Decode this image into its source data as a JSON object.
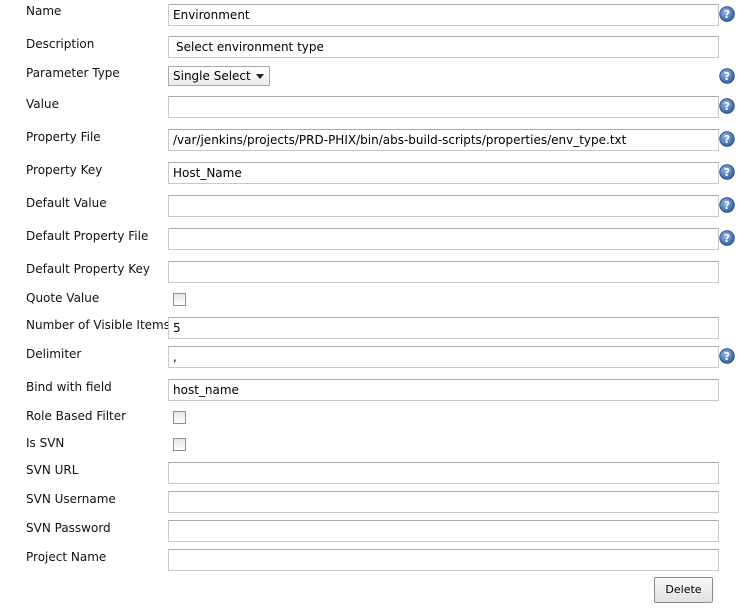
{
  "fields": {
    "name": {
      "label": "Name",
      "value": "Environment"
    },
    "description": {
      "label": "Description",
      "value": "Select environment type"
    },
    "parameter_type": {
      "label": "Parameter Type",
      "value": "Single Select"
    },
    "value": {
      "label": "Value",
      "value": ""
    },
    "property_file": {
      "label": "Property File",
      "value": "/var/jenkins/projects/PRD-PHIX/bin/abs-build-scripts/properties/env_type.txt"
    },
    "property_key": {
      "label": "Property Key",
      "value": "Host_Name"
    },
    "default_value": {
      "label": "Default Value",
      "value": ""
    },
    "default_property_file": {
      "label": "Default Property File",
      "value": ""
    },
    "default_property_key": {
      "label": "Default Property Key",
      "value": ""
    },
    "quote_value": {
      "label": "Quote Value",
      "checked": false
    },
    "visible_items": {
      "label": "Number of Visible Items",
      "value": "5"
    },
    "delimiter": {
      "label": "Delimiter",
      "value": ","
    },
    "bind_with_field": {
      "label": "Bind with field",
      "value": "host_name"
    },
    "role_based_filter": {
      "label": "Role Based Filter",
      "checked": false
    },
    "is_svn": {
      "label": "Is SVN",
      "checked": false
    },
    "svn_url": {
      "label": "SVN URL",
      "value": ""
    },
    "svn_username": {
      "label": "SVN Username",
      "value": ""
    },
    "svn_password": {
      "label": "SVN Password",
      "value": ""
    },
    "project_name": {
      "label": "Project Name",
      "value": ""
    }
  },
  "buttons": {
    "delete": "Delete"
  },
  "icons": {
    "help": "help-icon"
  },
  "colors": {
    "help_blue": "#3f73b5",
    "border": "#c8c8c8"
  }
}
